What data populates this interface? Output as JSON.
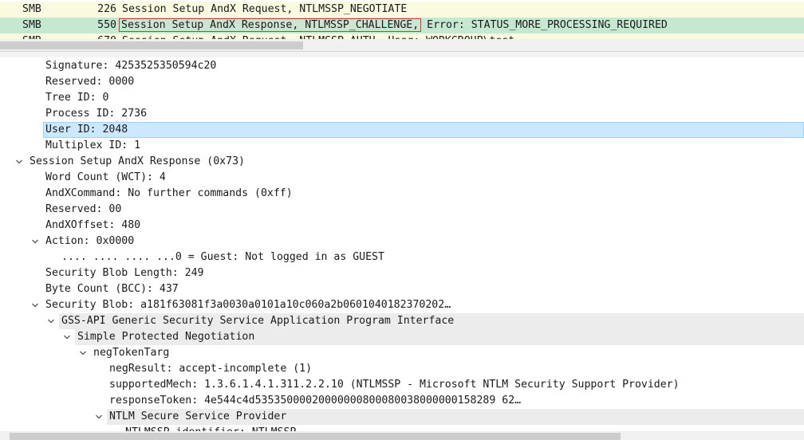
{
  "packet_list": {
    "rows": [
      {
        "protocol": "SMB",
        "length": "226",
        "info_main": "Session Setup AndX Request, NTLMSSP_NEGOTIATE",
        "info_rest": ""
      },
      {
        "protocol": "SMB",
        "length": "550",
        "info_main": "Session Setup AndX Response, NTLMSSP_CHALLENGE,",
        "info_rest": "Error: STATUS_MORE_PROCESSING_REQUIRED"
      },
      {
        "protocol": "SMB",
        "length": "670",
        "info_main": "Session Setup AndX Request, NTLMSSP_AUTH, User: WORKGROUP\\test",
        "info_rest": ""
      }
    ],
    "colors": {
      "row1_bg": "#fafae1",
      "row2_bg": "#c6e8d1",
      "row3_bg": "#fafae1"
    }
  },
  "details": {
    "rows": [
      {
        "text": "Signature: 4253525350594c20"
      },
      {
        "text": "Reserved: 0000"
      },
      {
        "text": "Tree ID: 0"
      },
      {
        "text": "Process ID: 2736"
      },
      {
        "text": "User ID: 2048"
      },
      {
        "text": "Multiplex ID: 1"
      },
      {
        "text": "Session Setup AndX Response (0x73)"
      },
      {
        "text": "Word Count (WCT): 4"
      },
      {
        "text": "AndXCommand: No further commands (0xff)"
      },
      {
        "text": "Reserved: 00"
      },
      {
        "text": "AndXOffset: 480"
      },
      {
        "text": "Action: 0x0000"
      },
      {
        "text": ".... .... .... ...0 = Guest: Not logged in as GUEST"
      },
      {
        "text": "Security Blob Length: 249"
      },
      {
        "text": "Byte Count (BCC): 437"
      },
      {
        "text": "Security Blob: a181f63081f3a0030a0101a10c060a2b0601040182370202…"
      },
      {
        "text": "GSS-API Generic Security Service Application Program Interface"
      },
      {
        "text": "Simple Protected Negotiation"
      },
      {
        "text": "negTokenTarg"
      },
      {
        "text": "negResult: accept-incomplete (1)"
      },
      {
        "text": "supportedMech: 1.3.6.1.4.1.311.2.2.10 (NTLMSSP - Microsoft NTLM Security Support Provider)"
      },
      {
        "text": "responseToken: 4e544c4d53535000020000000800080038000000158289 62…"
      },
      {
        "text": "NTLM Secure Service Provider"
      },
      {
        "text": "NTLMSSP identifier: NTLMSSP"
      }
    ],
    "colors": {
      "selected_bg": "#cce8ff",
      "band_bg": "#ececec"
    }
  }
}
